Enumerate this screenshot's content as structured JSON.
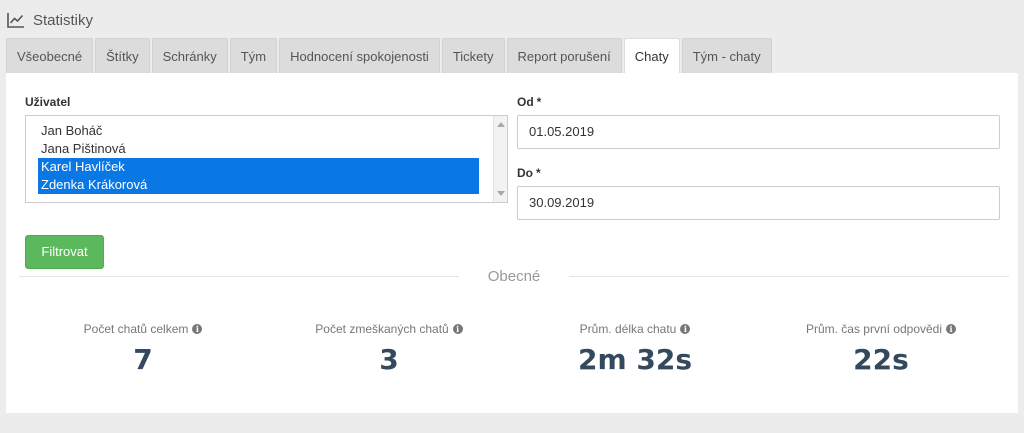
{
  "header": {
    "title": "Statistiky",
    "icon": "line-chart-icon"
  },
  "tabs": [
    {
      "label": "Všeobecné",
      "active": false
    },
    {
      "label": "Štítky",
      "active": false
    },
    {
      "label": "Schránky",
      "active": false
    },
    {
      "label": "Tým",
      "active": false
    },
    {
      "label": "Hodnocení spokojenosti",
      "active": false
    },
    {
      "label": "Tickety",
      "active": false
    },
    {
      "label": "Report porušení",
      "active": false
    },
    {
      "label": "Chaty",
      "active": true
    },
    {
      "label": "Tým - chaty",
      "active": false
    }
  ],
  "filters": {
    "user_label": "Uživatel",
    "users": [
      {
        "name": "Jan Boháč",
        "selected": false
      },
      {
        "name": "Jana Pištinová",
        "selected": false
      },
      {
        "name": "Karel Havlíček",
        "selected": true
      },
      {
        "name": "Zdenka Krákorová",
        "selected": true
      }
    ],
    "from_label": "Od",
    "from_value": "01.05.2019",
    "to_label": "Do",
    "to_value": "30.09.2019",
    "required_mark": "*",
    "submit_label": "Filtrovat"
  },
  "section": {
    "title": "Obecné"
  },
  "stats": [
    {
      "label": "Počet chatů celkem",
      "value": "7"
    },
    {
      "label": "Počet zmeškaných chatů",
      "value": "3"
    },
    {
      "label": "Prům. délka chatu",
      "value": "2m 32s"
    },
    {
      "label": "Prům. čas první odpovědi",
      "value": "22s"
    }
  ],
  "colors": {
    "selected_option": "#0a78e4",
    "button": "#5cb85c",
    "stat_value": "#34495e"
  }
}
